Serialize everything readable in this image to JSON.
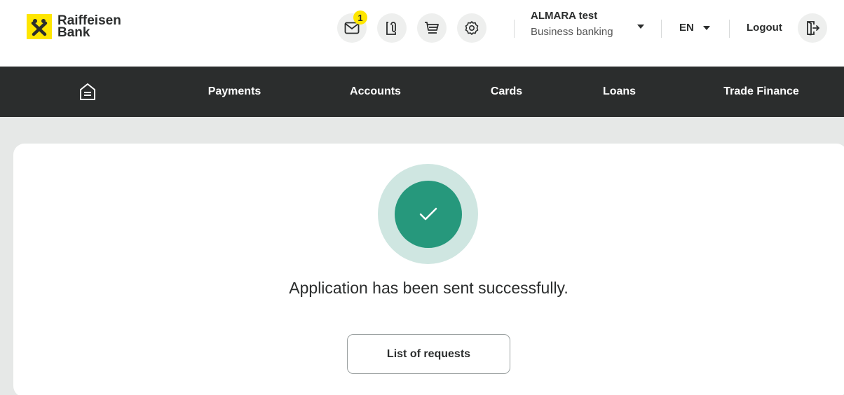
{
  "brand": {
    "line1": "Raiffeisen",
    "line2": "Bank",
    "color": "#fee600"
  },
  "header": {
    "messages_badge": "1",
    "account_name": "ALMARA test",
    "account_type": "Business banking",
    "language": "EN",
    "logout_label": "Logout",
    "icons": [
      "mail-icon",
      "documents-icon",
      "cart-icon",
      "settings-icon",
      "logout-icon"
    ]
  },
  "nav": {
    "items": [
      "Payments",
      "Accounts",
      "Cards",
      "Loans",
      "Trade Finance"
    ],
    "home_icon": "home-icon"
  },
  "main": {
    "message": "Application has been sent successfully.",
    "button_label": "List of requests",
    "success_color": "#26987c"
  }
}
